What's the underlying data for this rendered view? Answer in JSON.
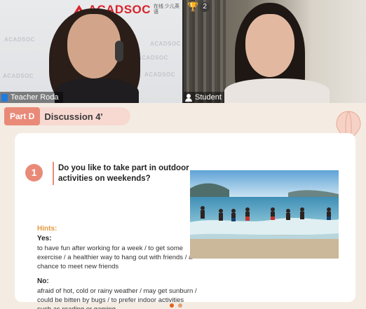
{
  "teacher": {
    "name": "Teacher Roda",
    "brand": "ACADSOC",
    "brand_sub": "在线 少儿英语",
    "watermark": "ACADSOC"
  },
  "student": {
    "name": "Student",
    "trophy_count": "2"
  },
  "slide": {
    "part_label": "Part D",
    "part_title": "Discussion 4'",
    "question_number": "1",
    "question": "Do you like to take part in outdoor activities on weekends?",
    "hints_label": "Hints:",
    "yes_label": "Yes:",
    "yes_text": "to have fun after working for a week / to get some exercise / a healthier way to hang out with friends / a chance to meet new friends",
    "no_label": "No:",
    "no_text": "afraid of hot, cold or rainy weather / may get sunburn / could be bitten by bugs / to prefer indoor activities such as reading or gaming"
  },
  "colors": {
    "accent": "#e98a78",
    "hints": "#e29a3e",
    "brand_red": "#d8232a",
    "page_bg": "#f4ece3"
  },
  "icons": {
    "trophy": "trophy-icon",
    "mic": "mic-icon",
    "user": "user-icon",
    "balloon": "hot-air-balloon-icon"
  },
  "pagination": {
    "active_index": 0
  }
}
